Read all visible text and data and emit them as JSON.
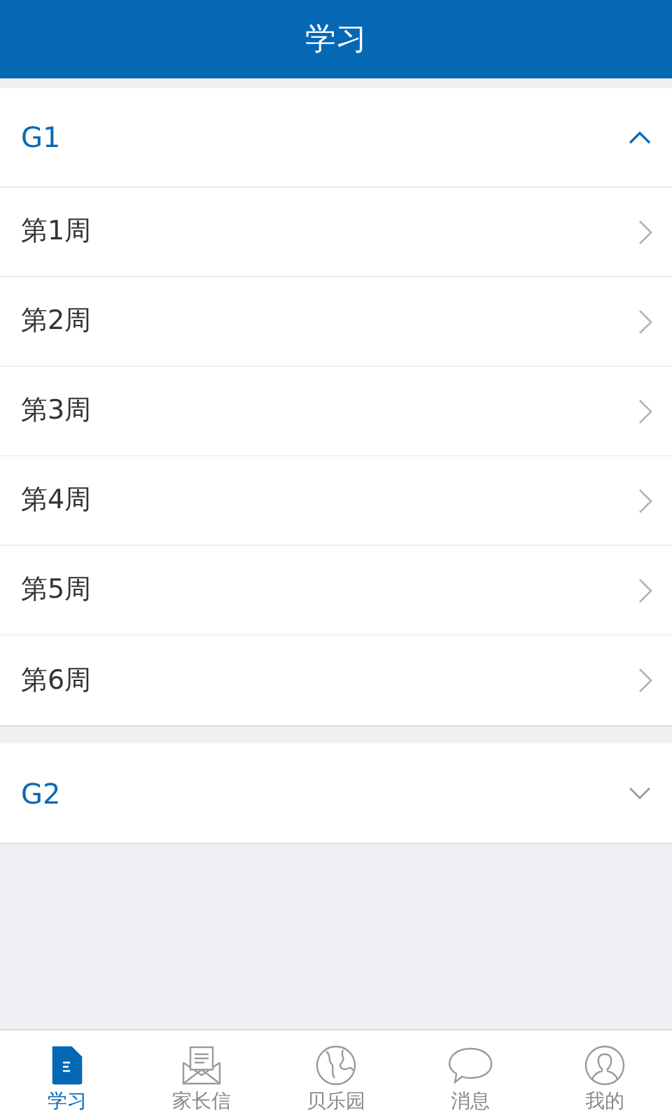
{
  "header": {
    "title": "学习"
  },
  "groups": [
    {
      "title": "G1",
      "expanded": true,
      "items": [
        {
          "label": "第1周"
        },
        {
          "label": "第2周"
        },
        {
          "label": "第3周"
        },
        {
          "label": "第4周"
        },
        {
          "label": "第5周"
        },
        {
          "label": "第6周"
        }
      ]
    },
    {
      "title": "G2",
      "expanded": false
    }
  ],
  "tab_bar": [
    {
      "label": "学习",
      "kind": "document",
      "selected": true
    },
    {
      "label": "家长信",
      "kind": "letter",
      "selected": false
    },
    {
      "label": "贝乐园",
      "kind": "globe",
      "selected": false
    },
    {
      "label": "消息",
      "kind": "chat",
      "selected": false
    },
    {
      "label": "我的",
      "kind": "person",
      "selected": false
    }
  ]
}
